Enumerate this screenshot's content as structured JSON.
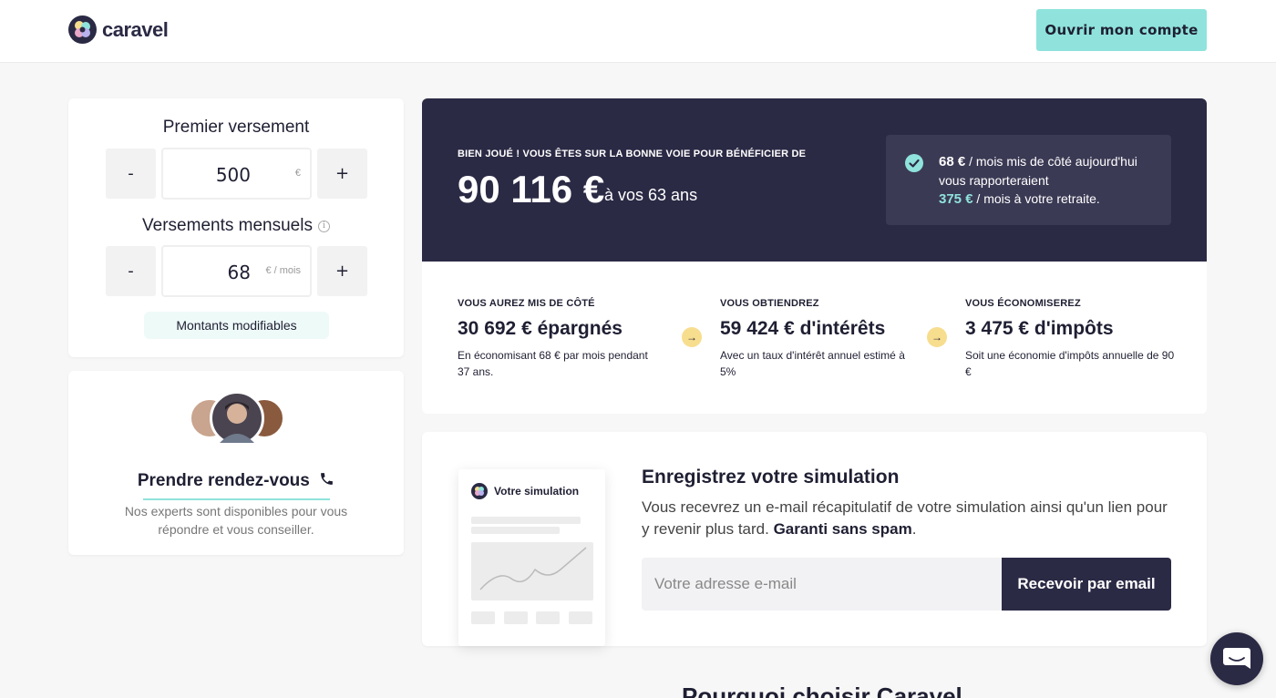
{
  "header": {
    "brand": "caravel",
    "open_account_label": "Ouvrir mon compte"
  },
  "calculator": {
    "initial": {
      "label": "Premier versement",
      "minus": "-",
      "plus": "+",
      "value": "500",
      "unit": "€"
    },
    "monthly": {
      "label": "Versements mensuels",
      "info": "i",
      "minus": "-",
      "plus": "+",
      "value": "68",
      "unit": "€ / mois"
    },
    "hint": "Montants modifiables"
  },
  "appointment": {
    "title": "Prendre rendez-vous",
    "description": "Nos experts sont disponibles pour vous répondre et vous conseiller."
  },
  "result": {
    "kicker": "BIEN JOUÉ ! VOUS ÊTES SUR LA BONNE VOIE POUR BÉNÉFICIER DE",
    "amount": "90 116 €",
    "age_text": "à vos 63 ans",
    "tip": {
      "monthly_amount": "68 €",
      "line1": " / mois mis de côté aujourd'hui vous rapporteraient",
      "retirement_amount": "375 €",
      "line2": " / mois à votre retraite."
    },
    "stats": [
      {
        "kicker": "VOUS AUREZ MIS DE CÔTÉ",
        "value": "30 692 € épargnés",
        "desc": "En économisant 68 € par mois pendant 37 ans."
      },
      {
        "kicker": "VOUS OBTIENDREZ",
        "value": "59 424 € d'intérêts",
        "desc": "Avec un taux d'intérêt annuel estimé à 5%"
      },
      {
        "kicker": "VOUS ÉCONOMISEREZ",
        "value": "3 475 € d'impôts",
        "desc": "Soit une économie d'impôts annuelle de 90 €"
      }
    ],
    "arrow": "→"
  },
  "save": {
    "mock_title": "Votre simulation",
    "title": "Enregistrez votre simulation",
    "desc": "Vous recevrez un e-mail récapitulatif de votre simulation ainsi qu'un lien pour y revenir plus tard. ",
    "desc_bold": "Garanti sans spam",
    "desc_end": ".",
    "email_placeholder": "Votre adresse e-mail",
    "button_label": "Recevoir par email"
  },
  "why_title": "Pourquoi choisir Caravel",
  "colors": {
    "navy": "#2b2a45",
    "teal": "#8fe3dc",
    "yellow": "#f7dd8e"
  }
}
